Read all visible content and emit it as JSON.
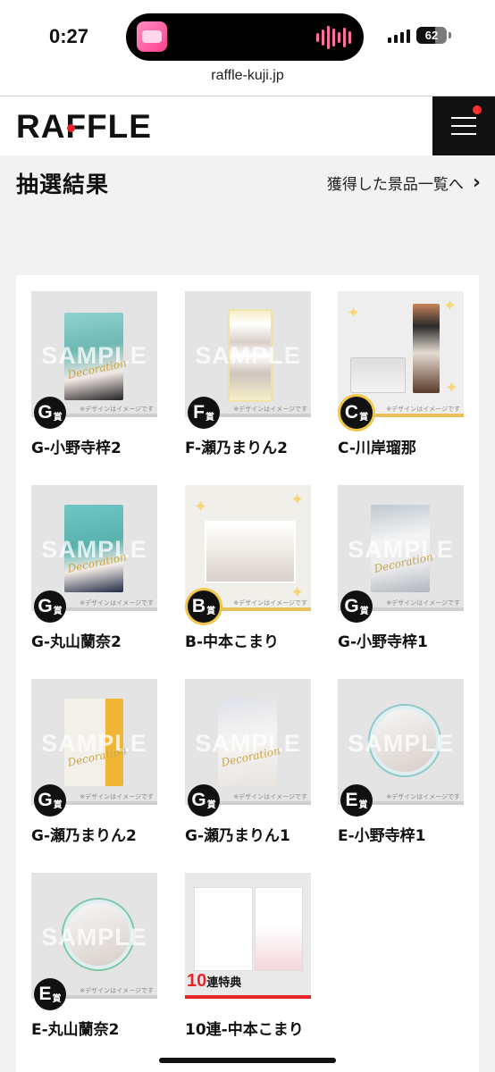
{
  "status_bar": {
    "time": "0:27",
    "battery": "62",
    "battery_level": 0.62
  },
  "browser": {
    "url": "raffle-kuji.jp"
  },
  "header": {
    "logo": "RAFFLE"
  },
  "page": {
    "title": "抽選結果",
    "prize_list_link": "獲得した景品一覧へ"
  },
  "common": {
    "sample": "SAMPLE",
    "decoration": "Decoration",
    "note": "※デザインはイメージです",
    "prize_suffix": "賞"
  },
  "cards": [
    {
      "grade": "G",
      "label": "G-小野寺梓2"
    },
    {
      "grade": "F",
      "label": "F-瀬乃まりん2"
    },
    {
      "grade": "C",
      "label": "C-川岸瑠那"
    },
    {
      "grade": "G",
      "label": "G-丸山蘭奈2"
    },
    {
      "grade": "B",
      "label": "B-中本こまり"
    },
    {
      "grade": "G",
      "label": "G-小野寺梓1"
    },
    {
      "grade": "G",
      "label": "G-瀬乃まりん2"
    },
    {
      "grade": "G",
      "label": "G-瀬乃まりん1"
    },
    {
      "grade": "E",
      "label": "E-小野寺梓1"
    },
    {
      "grade": "E",
      "label": "E-丸山蘭奈2"
    },
    {
      "bonus_num": "10",
      "bonus_text": "連特典",
      "label": "10連-中本こまり"
    }
  ],
  "colors": {
    "accent_red": "#e8242b",
    "gold": "#f0c64b",
    "dark": "#111111"
  },
  "icons": {
    "menu": "hamburger-icon",
    "chevron": "chevron-right-icon"
  }
}
